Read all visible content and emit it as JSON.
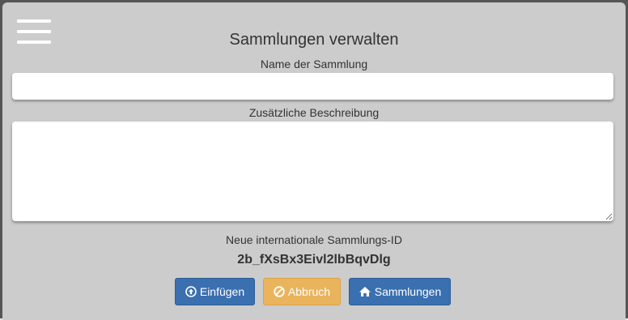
{
  "header": {
    "title": "Sammlungen verwalten",
    "menu_icon": "hamburger-menu-icon"
  },
  "form": {
    "name_label": "Name der Sammlung",
    "name_value": "",
    "description_label": "Zusätzliche Beschreibung",
    "description_value": "",
    "id_label": "Neue internationale Sammlungs-ID",
    "id_value": "2b_fXsBx3Eivl2lbBqvDlg"
  },
  "buttons": {
    "insert": {
      "label": "Einfügen",
      "icon": "upload-circle-icon",
      "color": "#3a6fb0"
    },
    "cancel": {
      "label": "Abbruch",
      "icon": "ban-icon",
      "color": "#e9b45c"
    },
    "collections": {
      "label": "Sammlungen",
      "icon": "home-icon",
      "color": "#3a6fb0"
    }
  },
  "colors": {
    "panel_bg": "#cccccc",
    "frame": "#555555",
    "text": "#333333"
  }
}
